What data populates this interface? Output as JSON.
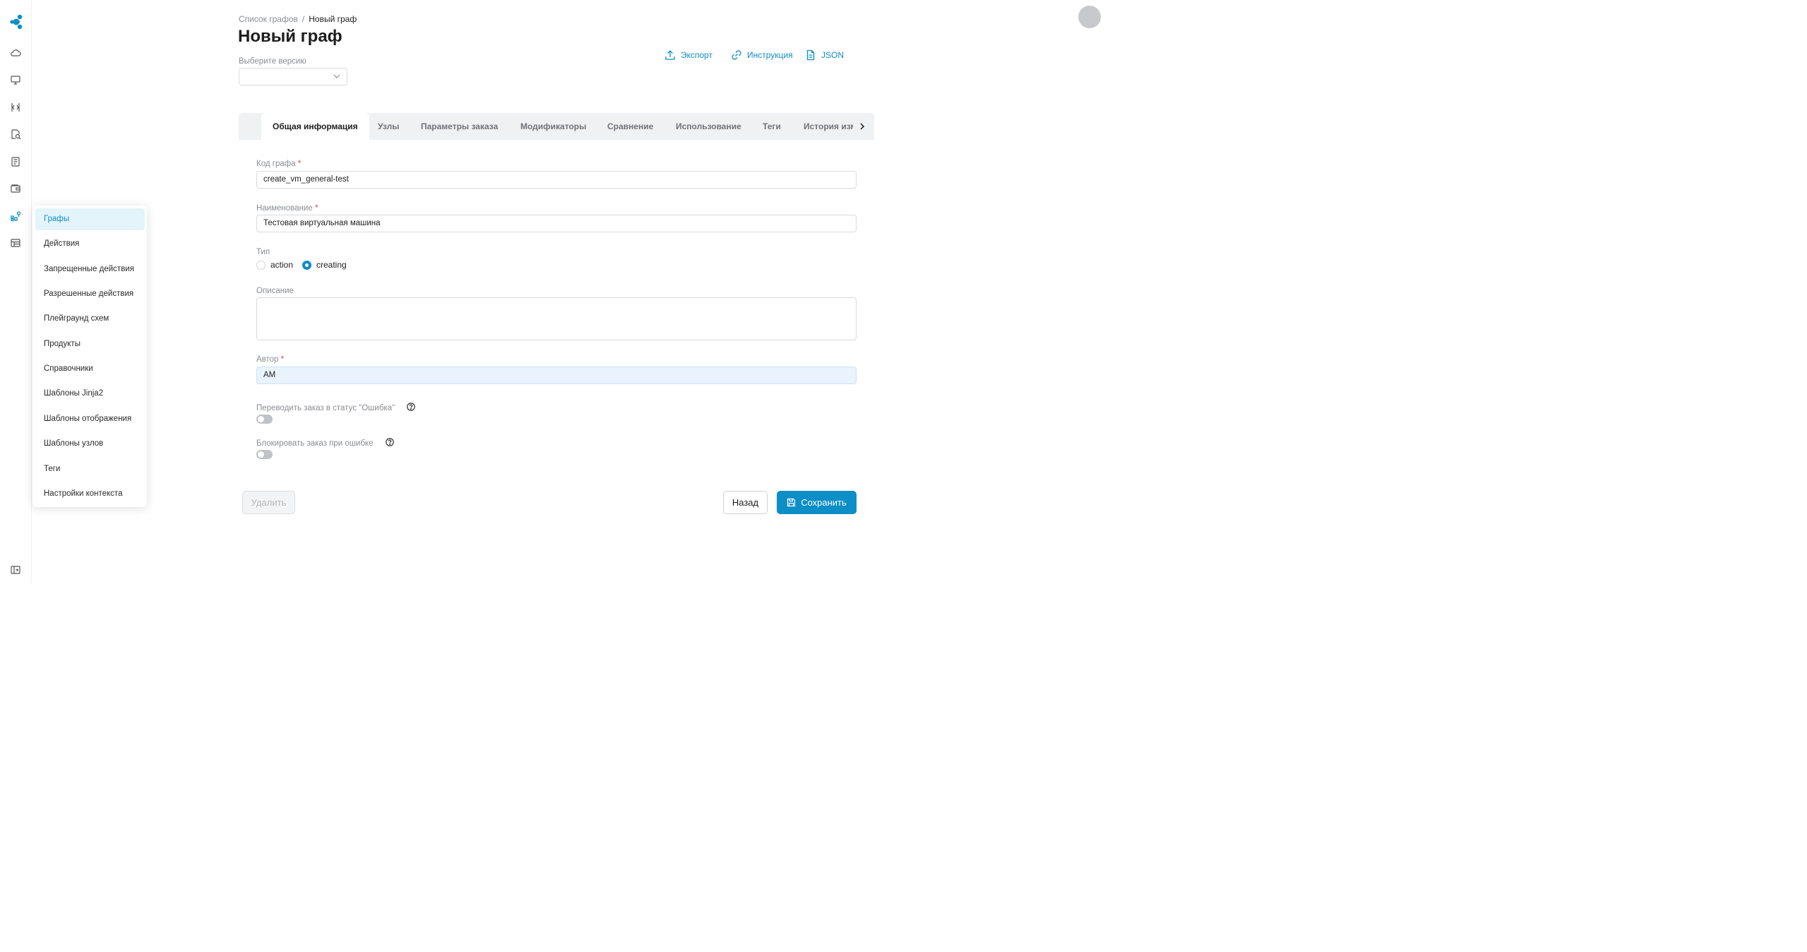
{
  "breadcrumb": {
    "parent": "Список графов",
    "separator": "/",
    "current": "Новый граф"
  },
  "page_title": "Новый граф",
  "version": {
    "label": "Выберите версию",
    "value": ""
  },
  "actions": {
    "export": "Экспорт",
    "instructions": "Инструкция",
    "json": "JSON"
  },
  "tabs": [
    "Общая информация",
    "Узлы",
    "Параметры заказа",
    "Модификаторы",
    "Сравнение",
    "Использование",
    "Теги",
    "История изм"
  ],
  "form": {
    "code": {
      "label": "Код графа",
      "required": "*",
      "value": "create_vm_general-test"
    },
    "name": {
      "label": "Наименование",
      "required": "*",
      "value": "Тестовая виртуальная машина"
    },
    "type": {
      "label": "Тип",
      "options": [
        "action",
        "creating"
      ],
      "selected": "creating"
    },
    "description": {
      "label": "Описание",
      "value": ""
    },
    "author": {
      "label": "Автор",
      "required": "*",
      "value": "AM"
    },
    "error_status": {
      "label": "Переводить заказ в статус \"Ошибка\"",
      "on": false
    },
    "block_on_error": {
      "label": "Блокировать заказ при ошибке",
      "on": false
    }
  },
  "buttons": {
    "delete": "Удалить",
    "back": "Назад",
    "save": "Сохранить"
  },
  "menu": {
    "items": [
      "Графы",
      "Действия",
      "Запрещенные действия",
      "Разрешенные действия",
      "Плейграунд схем",
      "Продукты",
      "Справочники",
      "Шаблоны Jinja2",
      "Шаблоны отображения",
      "Шаблоны узлов",
      "Теги",
      "Настройки контекста"
    ],
    "active": "Графы"
  },
  "colors": {
    "accent": "#0d8ec7",
    "active_menu_bg": "#e3f4fa",
    "required": "#e0413b"
  },
  "icons": {
    "rail": [
      "logo-icon",
      "cloud-icon",
      "monitor-icon",
      "code-icon",
      "search-doc-icon",
      "document-icon",
      "wallet-icon",
      "graph-icon",
      "table-icon",
      "sidebar-toggle-icon"
    ],
    "actions": [
      "upload-icon",
      "link-icon",
      "file-icon"
    ]
  }
}
